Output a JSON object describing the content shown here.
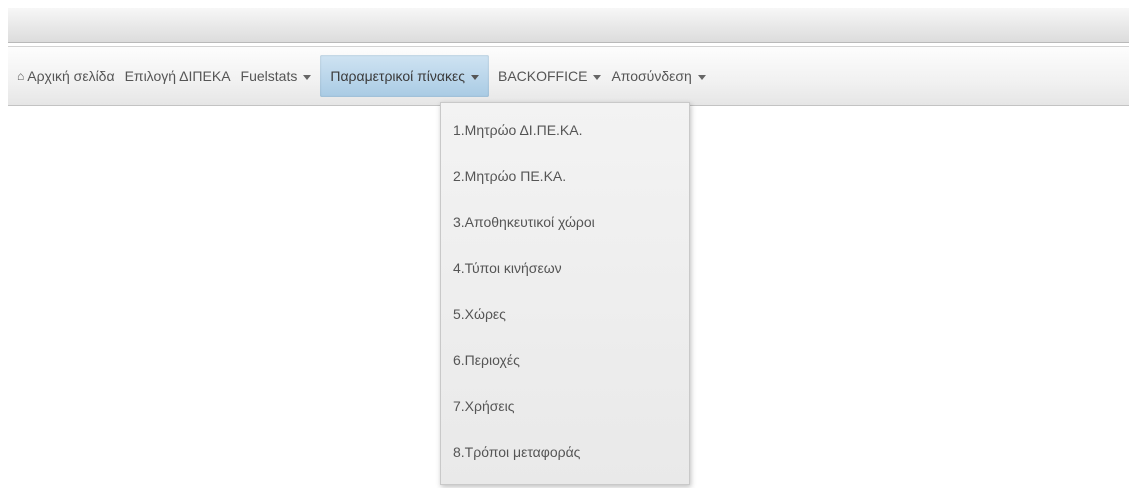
{
  "navbar": {
    "home_icon": "home-icon",
    "items": [
      {
        "label": "Αρχική σελίδα",
        "has_caret": false
      },
      {
        "label": "Επιλογή ΔΙΠΕΚΑ",
        "has_caret": false
      },
      {
        "label": "Fuelstats",
        "has_caret": true
      },
      {
        "label": "Παραμετρικοί πίνακες",
        "has_caret": true,
        "active": true
      },
      {
        "label": "BACKOFFICE",
        "has_caret": true
      },
      {
        "label": "Αποσύνδεση",
        "has_caret": true
      }
    ],
    "active_color": "#b9d7ec"
  },
  "dropdown": {
    "items": [
      "1.Μητρώο ΔΙ.ΠΕ.ΚΑ.",
      "2.Μητρώο ΠΕ.ΚΑ.",
      "3.Αποθηκευτικοί χώροι",
      "4.Τύποι κινήσεων",
      "5.Χώρες",
      "6.Περιοχές",
      "7.Χρήσεις",
      "8.Τρόποι μεταφοράς"
    ]
  }
}
